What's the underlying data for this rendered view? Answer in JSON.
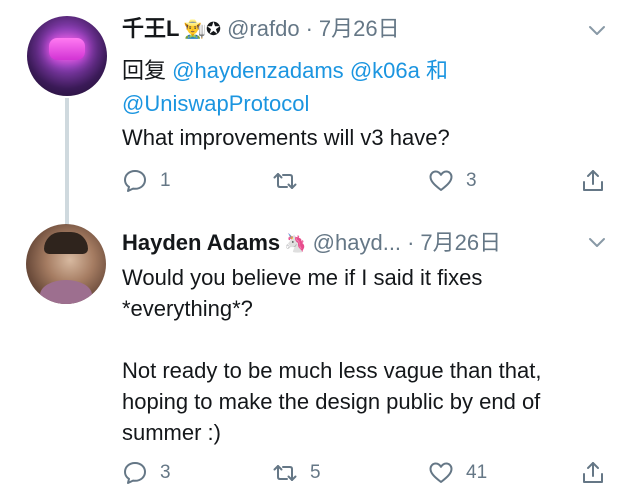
{
  "tweets": [
    {
      "display_name": "千王L",
      "name_emoji": "👨‍🌾✪",
      "handle": "@rafdo",
      "separator": "·",
      "date": "7月26日",
      "reply_prefix": "回复",
      "reply_mentions": [
        "@haydenzadams",
        "@k06a"
      ],
      "reply_joiner": "和",
      "reply_last_mention": "@UniswapProtocol",
      "body": "What improvements will v3 have?",
      "actions": {
        "reply_count": "1",
        "retweet_count": "",
        "like_count": "3"
      }
    },
    {
      "display_name": "Hayden Adams",
      "name_emoji": "🦄",
      "handle": "@hayd...",
      "separator": "·",
      "date": "7月26日",
      "body": "Would you believe me if I said it fixes\n*everything*?\n\nNot ready to be much less vague than that,\nhoping to make the design public by end of\nsummer :)",
      "actions": {
        "reply_count": "3",
        "retweet_count": "5",
        "like_count": "41"
      }
    }
  ],
  "colors": {
    "text": "#14171a",
    "muted": "#657786",
    "link": "#1b95e0",
    "thread_line": "#cfd9de"
  },
  "icons": {
    "reply": "speech-bubble-icon",
    "retweet": "retweet-arrows-icon",
    "like": "heart-outline-icon",
    "share": "share-arrow-up-icon",
    "menu": "chevron-down-icon"
  }
}
